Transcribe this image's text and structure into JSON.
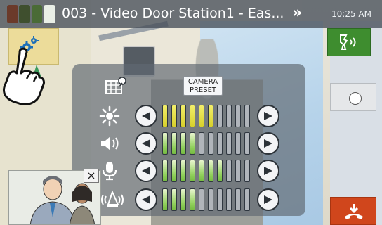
{
  "header": {
    "station_title": "003 - Video Door Station1 - Eas...",
    "time": "10:25 AM",
    "more_icon": "double-chevron-right-icon"
  },
  "panel": {
    "camera_preset_label": "CAMERA\nPRESET",
    "rows": [
      {
        "name": "brightness",
        "icon": "sun-icon",
        "level": 6,
        "max": 10,
        "color": "#e0da3a"
      },
      {
        "name": "speaker-volume",
        "icon": "speaker-icon",
        "level": 4,
        "max": 10,
        "color": "#7ec24a"
      },
      {
        "name": "microphone-volume",
        "icon": "microphone-icon",
        "level": 7,
        "max": 10,
        "color": "#7ec24a"
      },
      {
        "name": "ringtone-volume",
        "icon": "bell-icon",
        "level": 4,
        "max": 10,
        "color": "#7ec24a"
      }
    ]
  },
  "side_buttons": {
    "settings_icon": "gear-icon",
    "call_icon": "talk-icon",
    "shutter_icon": "shutter-icon",
    "end_icon": "hang-up-icon"
  },
  "sub_screen": {
    "close_label": "×"
  }
}
